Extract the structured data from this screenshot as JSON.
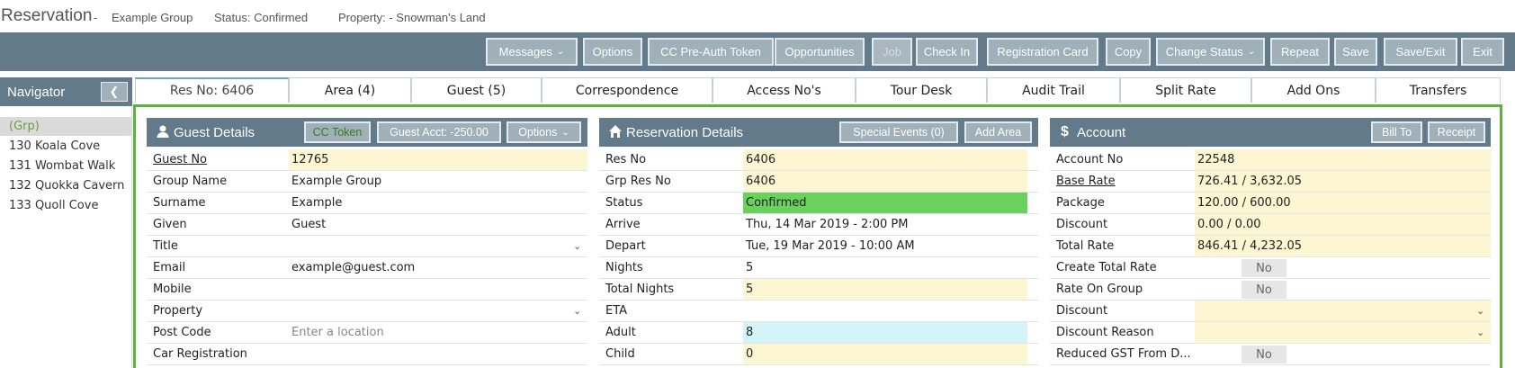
{
  "header": {
    "title": "Reservation",
    "separator": "-",
    "group": "Example Group",
    "status": "Status: Confirmed",
    "property": "Property: - Snowman's Land"
  },
  "toolbar": {
    "messages": "Messages",
    "options": "Options",
    "cc_preauth": "CC Pre-Auth Token",
    "opportunities": "Opportunities",
    "job": "Job",
    "check_in": "Check In",
    "registration_card": "Registration Card",
    "copy": "Copy",
    "change_status": "Change Status",
    "repeat": "Repeat",
    "save": "Save",
    "save_exit": "Save/Exit",
    "exit": "Exit"
  },
  "navigator": {
    "title": "Navigator",
    "collapse_icon": "chevron-left-icon",
    "items": [
      "(Grp)",
      "130 Koala Cove",
      "131 Wombat Walk",
      "132 Quokka Cavern",
      "133 Quoll Cove"
    ]
  },
  "tabs": [
    "Res No: 6406",
    "Area (4)",
    "Guest (5)",
    "Correspondence",
    "Access No's",
    "Tour Desk",
    "Audit Trail",
    "Split Rate",
    "Add Ons",
    "Transfers"
  ],
  "guest_panel": {
    "title": "Guest Details",
    "icon": "user-icon",
    "cc_token": "CC Token",
    "guest_acct": "Guest Acct: -250.00",
    "options": "Options",
    "rows": [
      {
        "label": "Guest No",
        "value": "12765"
      },
      {
        "label": "Group Name",
        "value": "Example Group"
      },
      {
        "label": "Surname",
        "value": "Example"
      },
      {
        "label": "Given",
        "value": "Guest"
      },
      {
        "label": "Title",
        "value": ""
      },
      {
        "label": "Email",
        "value": "example@guest.com"
      },
      {
        "label": "Mobile",
        "value": ""
      },
      {
        "label": "Property",
        "value": ""
      },
      {
        "label": "Post Code",
        "value": "",
        "placeholder": "Enter a location"
      },
      {
        "label": "Car Registration",
        "value": ""
      }
    ]
  },
  "reservation_panel": {
    "title": "Reservation Details",
    "icon": "home-icon",
    "special_events": "Special Events (0)",
    "add_area": "Add Area",
    "rows": [
      {
        "label": "Res No",
        "value": "6406"
      },
      {
        "label": "Grp Res No",
        "value": "6406"
      },
      {
        "label": "Status",
        "value": "Confirmed"
      },
      {
        "label": "Arrive",
        "value": "Thu, 14 Mar 2019 - 2:00 PM"
      },
      {
        "label": "Depart",
        "value": "Tue, 19 Mar 2019 - 10:00 AM"
      },
      {
        "label": "Nights",
        "value": "5"
      },
      {
        "label": "Total Nights",
        "value": "5"
      },
      {
        "label": "ETA",
        "value": ""
      },
      {
        "label": "Adult",
        "value": "8"
      },
      {
        "label": "Child",
        "value": "0"
      }
    ]
  },
  "account_panel": {
    "title": "Account",
    "icon": "dollar-icon",
    "bill_to": "Bill To",
    "receipt": "Receipt",
    "rows": [
      {
        "label": "Account No",
        "value": "22548"
      },
      {
        "label": "Base Rate",
        "value": "726.41 / 3,632.05"
      },
      {
        "label": "Package",
        "value": "120.00 / 600.00"
      },
      {
        "label": "Discount",
        "value": "0.00 / 0.00"
      },
      {
        "label": "Total Rate",
        "value": "846.41 / 4,232.05"
      },
      {
        "label": "Create Total Rate",
        "value": "No"
      },
      {
        "label": "Rate On Group",
        "value": "No"
      },
      {
        "label": "Discount",
        "value": ""
      },
      {
        "label": "Discount Reason",
        "value": ""
      },
      {
        "label": "Reduced GST From D...",
        "value": "No"
      }
    ]
  },
  "colors": {
    "toolbar": "#627a89",
    "button": "#9fb0b8",
    "accent_green": "#5cb33c",
    "status_confirmed": "#6ad25c",
    "field_yellow": "#fcf6d2",
    "field_cyan": "#d4f4f8"
  }
}
